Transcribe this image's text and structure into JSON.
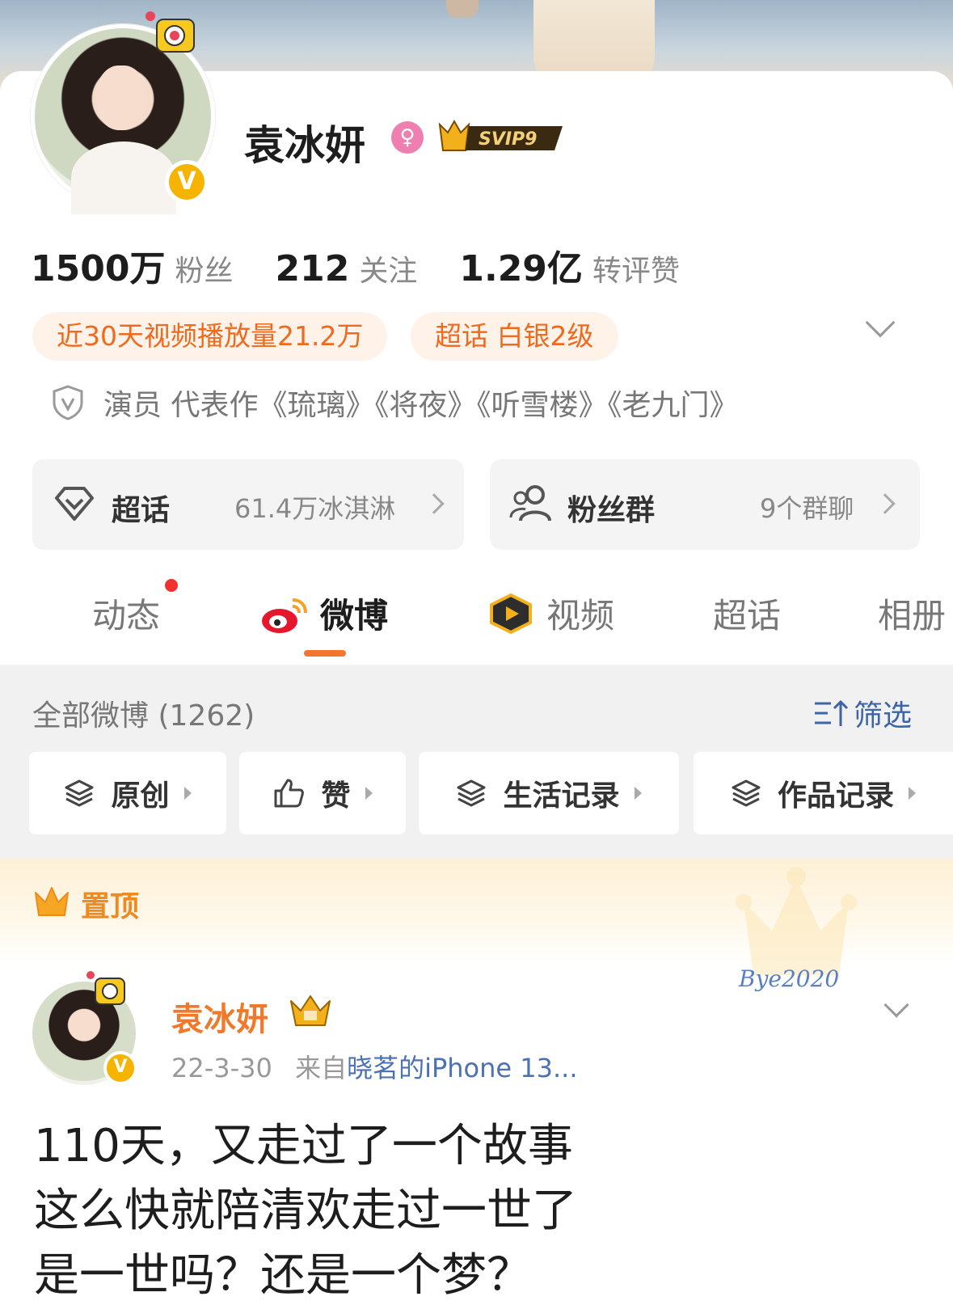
{
  "profile": {
    "name": "袁冰妍",
    "svip_label": "SVIP9",
    "gender_icon": "female-icon",
    "verified_icon": "V"
  },
  "stats": [
    {
      "value": "1500万",
      "label": "粉丝"
    },
    {
      "value": "212",
      "label": "关注"
    },
    {
      "value": "1.29亿",
      "label": "转评赞"
    }
  ],
  "tags": {
    "video_plays": "近30天视频播放量21.2万",
    "supertopic_level": "超话 白银2级"
  },
  "intro": "演员 代表作《琉璃》《将夜》《听雪楼》《老九门》",
  "cards": {
    "supertopic": {
      "title": "超话",
      "meta": "61.4万冰淇淋"
    },
    "fan_group": {
      "title": "粉丝群",
      "meta": "9个群聊"
    }
  },
  "tabs": [
    "动态",
    "微博",
    "视频",
    "超话",
    "相册"
  ],
  "feed": {
    "all_label": "全部微博",
    "count": "(1262)",
    "filter_label": "筛选",
    "chips": [
      "原创",
      "赞",
      "生活记录",
      "作品记录"
    ]
  },
  "pinned": {
    "label": "置顶",
    "decoration_text": "Bye2020"
  },
  "post": {
    "author": "袁冰妍",
    "date": "22-3-30",
    "source_prefix": "来自",
    "source": "晓茗的iPhone 13...",
    "lines": [
      "110天，又走过了一个故事",
      "这么快就陪清欢走过一世了",
      "是一世吗？还是一个梦？"
    ]
  },
  "colors": {
    "accent_orange": "#f2762e",
    "link_blue": "#4b72b4",
    "vip_gold": "#f6b400"
  }
}
